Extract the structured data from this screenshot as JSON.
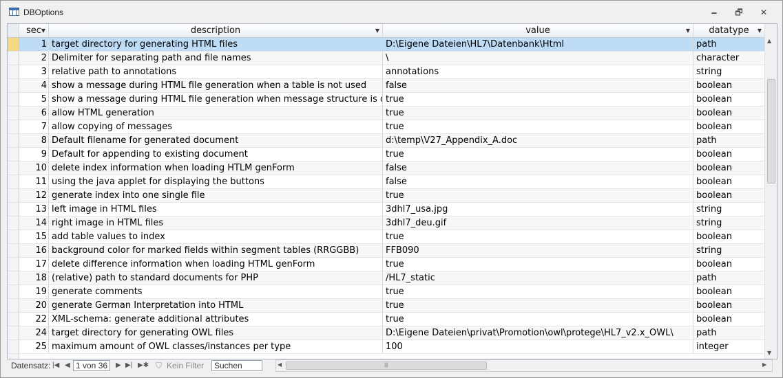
{
  "window": {
    "title": "DBOptions",
    "minimize": "🗕",
    "restore": "🗗",
    "close": "✕"
  },
  "columns": {
    "sec": "sec",
    "description": "description",
    "value": "value",
    "datatype": "datatype"
  },
  "rows": [
    {
      "sec": "1",
      "description": "target directory for generating HTML files",
      "value": "D:\\Eigene Dateien\\HL7\\Datenbank\\Html",
      "datatype": "path"
    },
    {
      "sec": "2",
      "description": "Delimiter for separating path and file names",
      "value": "\\",
      "datatype": "character"
    },
    {
      "sec": "3",
      "description": "relative path to annotations",
      "value": "annotations",
      "datatype": "string"
    },
    {
      "sec": "4",
      "description": "show a message during HTML file generation when a table is not used",
      "value": "false",
      "datatype": "boolean"
    },
    {
      "sec": "5",
      "description": "show a message during HTML file generation when message structure is damaged",
      "value": "true",
      "datatype": "boolean"
    },
    {
      "sec": "6",
      "description": "allow HTML generation",
      "value": "true",
      "datatype": "boolean"
    },
    {
      "sec": "7",
      "description": "allow copying of messages",
      "value": "true",
      "datatype": "boolean"
    },
    {
      "sec": "8",
      "description": "Default filename for generated document",
      "value": "d:\\temp\\V27_Appendix_A.doc",
      "datatype": "path"
    },
    {
      "sec": "9",
      "description": "Default for appending to existing document",
      "value": "true",
      "datatype": "boolean"
    },
    {
      "sec": "10",
      "description": "delete index information when loading HTLM genForm",
      "value": "false",
      "datatype": "boolean"
    },
    {
      "sec": "11",
      "description": "using the java applet for displaying the buttons",
      "value": "false",
      "datatype": "boolean"
    },
    {
      "sec": "12",
      "description": "generate index into one single file",
      "value": "true",
      "datatype": "boolean"
    },
    {
      "sec": "13",
      "description": "left image in HTML files",
      "value": "3dhl7_usa.jpg",
      "datatype": "string"
    },
    {
      "sec": "14",
      "description": "right image in HTML files",
      "value": "3dhl7_deu.gif",
      "datatype": "string"
    },
    {
      "sec": "15",
      "description": "add table values to index",
      "value": "true",
      "datatype": "boolean"
    },
    {
      "sec": "16",
      "description": "background color for marked fields within segment tables (RRGGBB)",
      "value": "FFB090",
      "datatype": "string"
    },
    {
      "sec": "17",
      "description": "delete difference information when loading HTML genForm",
      "value": "true",
      "datatype": "boolean"
    },
    {
      "sec": "18",
      "description": "(relative) path to standard documents for PHP",
      "value": "/HL7_static",
      "datatype": "path"
    },
    {
      "sec": "19",
      "description": "generate comments",
      "value": "true",
      "datatype": "boolean"
    },
    {
      "sec": "20",
      "description": "generate German Interpretation into HTML",
      "value": "true",
      "datatype": "boolean"
    },
    {
      "sec": "22",
      "description": "XML-schema: generate additional attributes",
      "value": "true",
      "datatype": "boolean"
    },
    {
      "sec": "24",
      "description": "target directory for generating OWL files",
      "value": "D:\\Eigene Dateien\\privat\\Promotion\\owl\\protege\\HL7_v2.x_OWL\\",
      "datatype": "path"
    },
    {
      "sec": "25",
      "description": "maximum amount of OWL classes/instances per type",
      "value": "100",
      "datatype": "integer"
    }
  ],
  "statusbar": {
    "record_label": "Datensatz:",
    "record_position": "1 von 36",
    "filter_label": "Kein Filter",
    "search_label": "Suchen"
  }
}
